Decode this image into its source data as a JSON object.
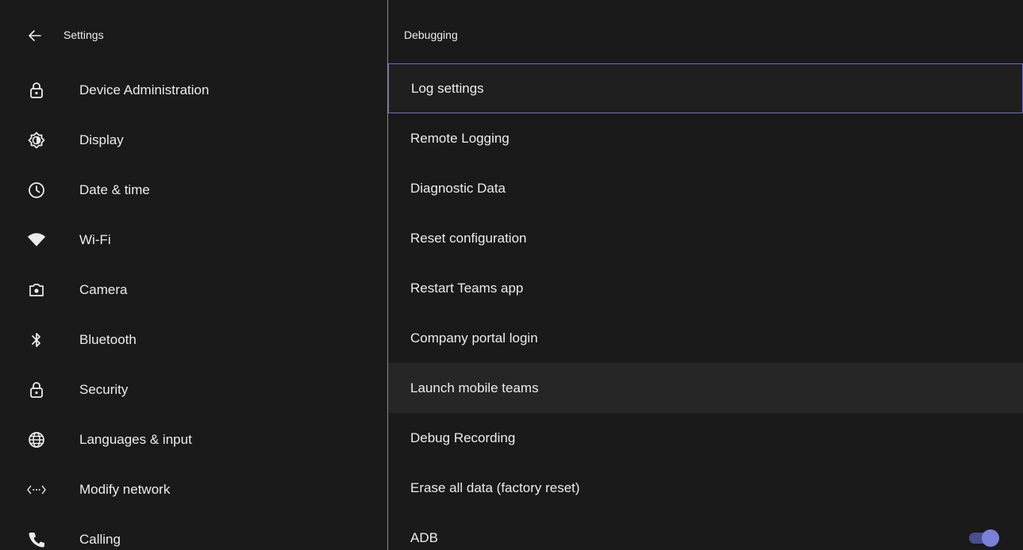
{
  "left_pane": {
    "title": "Settings",
    "back_icon": "arrow-left-icon",
    "items": [
      {
        "label": "Device Administration",
        "icon": "lock-icon"
      },
      {
        "label": "Display",
        "icon": "brightness-icon"
      },
      {
        "label": "Date & time",
        "icon": "clock-icon"
      },
      {
        "label": "Wi-Fi",
        "icon": "wifi-icon"
      },
      {
        "label": "Camera",
        "icon": "camera-icon"
      },
      {
        "label": "Bluetooth",
        "icon": "bluetooth-icon"
      },
      {
        "label": "Security",
        "icon": "lock-icon"
      },
      {
        "label": "Languages & input",
        "icon": "globe-icon"
      },
      {
        "label": "Modify network",
        "icon": "network-code-icon"
      },
      {
        "label": "Calling",
        "icon": "phone-icon"
      }
    ]
  },
  "right_pane": {
    "title": "Debugging",
    "items": [
      {
        "label": "Log settings",
        "state": "selected"
      },
      {
        "label": "Remote Logging",
        "state": "normal"
      },
      {
        "label": "Diagnostic Data",
        "state": "normal"
      },
      {
        "label": "Reset configuration",
        "state": "normal"
      },
      {
        "label": "Restart Teams app",
        "state": "normal"
      },
      {
        "label": "Company portal login",
        "state": "normal"
      },
      {
        "label": "Launch mobile teams",
        "state": "hovered"
      },
      {
        "label": "Debug Recording",
        "state": "normal"
      },
      {
        "label": "Erase all data (factory reset)",
        "state": "normal"
      },
      {
        "label": "ADB",
        "state": "normal",
        "toggle_on": true
      }
    ]
  },
  "colors": {
    "background": "#1a1a1a",
    "text": "#ececec",
    "accent": "#7b80d9",
    "selection_border": "#6b6fc4",
    "hover_bg": "#262626"
  }
}
